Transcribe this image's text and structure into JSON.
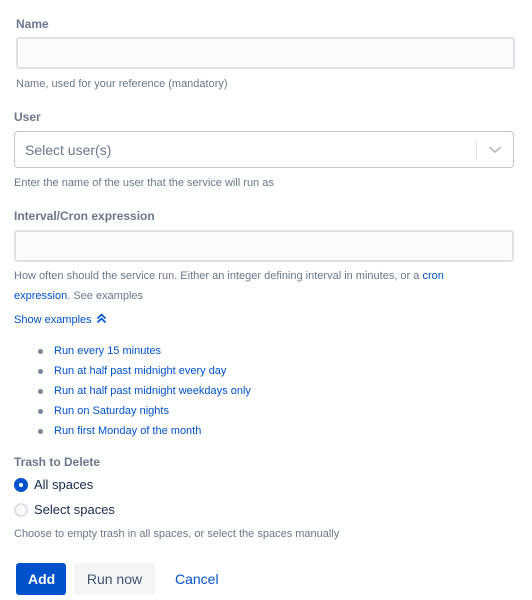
{
  "name_field": {
    "label": "Name",
    "value": "",
    "placeholder": "",
    "help": "Name, used for your reference (mandatory)"
  },
  "user_field": {
    "label": "User",
    "placeholder": "Select user(s)",
    "dropdown_icon": "chevron-down-icon",
    "help": "Enter the name of the user that the service will run as"
  },
  "interval_field": {
    "label": "Interval/Cron expression",
    "value": "",
    "placeholder": "",
    "help_prefix": "How often should the service run. Either an integer defining interval in minutes, or a ",
    "help_link": "cron expression",
    "help_link_line1": "cron",
    "help_link_line2": "expression",
    "help_suffix": ". See examples",
    "toggle_label": "Show examples",
    "toggle_icon": "double-chevron-up-icon",
    "examples": [
      "Run every 15 minutes",
      "Run at half past midnight every day",
      "Run at half past midnight weekdays only",
      "Run on Saturday nights",
      "Run first Monday of the month"
    ]
  },
  "trash_field": {
    "label": "Trash to Delete",
    "options": [
      {
        "label": "All spaces",
        "checked": true
      },
      {
        "label": "Select spaces",
        "checked": false
      }
    ],
    "help": "Choose to empty trash in all spaces, or select the spaces manually"
  },
  "actions": {
    "add": "Add",
    "run_now": "Run now",
    "cancel": "Cancel"
  },
  "colors": {
    "primary": "#0052cc",
    "label": "#6b778c",
    "text": "#172b4d"
  }
}
